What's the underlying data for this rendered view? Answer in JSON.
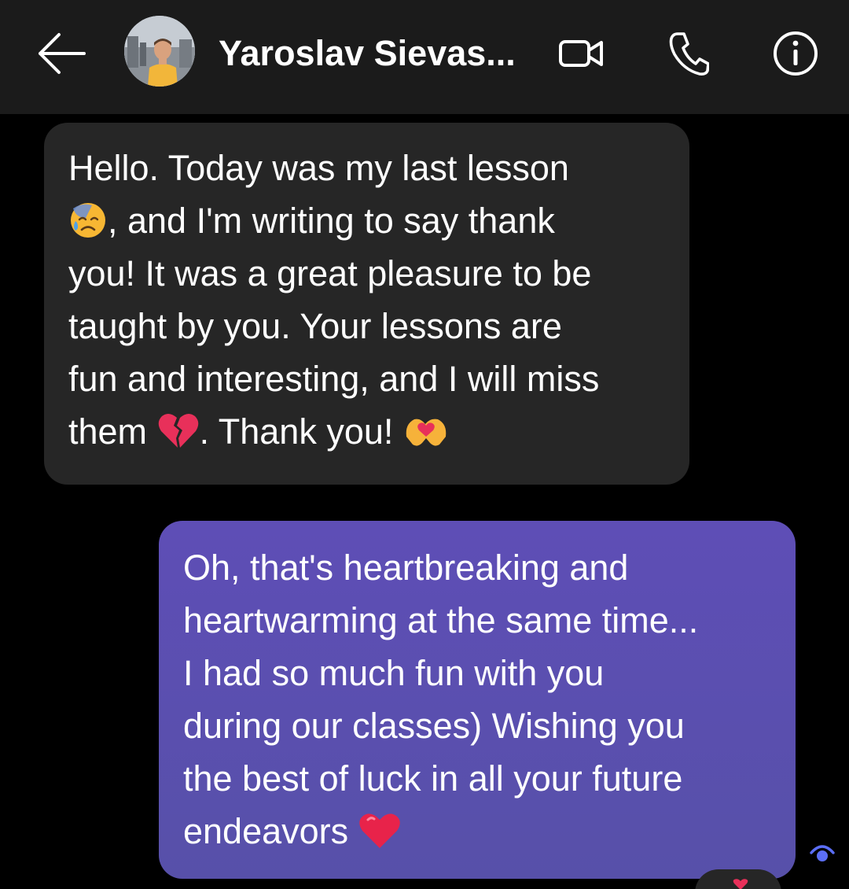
{
  "header": {
    "contact_name": "Yaroslav Sievas...",
    "icons": {
      "back": "arrow-left-icon",
      "video": "video-camera-icon",
      "call": "phone-icon",
      "info": "info-icon"
    }
  },
  "messages": [
    {
      "direction": "incoming",
      "lines": [
        "Hello. Today was my last lesson",
        ", and I'm writing to say thank",
        "you! It was a great pleasure to be",
        "taught by you. Your lessons are",
        "fun and interesting, and I will miss",
        "them",
        ". Thank you!"
      ],
      "emojis": [
        "sad-sweat-emoji",
        "broken-heart-emoji",
        "heart-hands-emoji"
      ]
    },
    {
      "direction": "outgoing",
      "lines": [
        "Oh, that's heartbreaking and",
        "heartwarming at the same time...",
        "I had so much fun with you",
        "during our classes) Wishing you",
        "the best of luck in all your future",
        "endeavors"
      ],
      "emojis": [
        "red-heart-emoji"
      ]
    }
  ],
  "colors": {
    "background": "#000000",
    "header": "#1b1b1b",
    "incoming_bubble": "#262626",
    "outgoing_bubble": "#5a4fb0",
    "text": "#ffffff",
    "accent": "#5b6ef5"
  }
}
